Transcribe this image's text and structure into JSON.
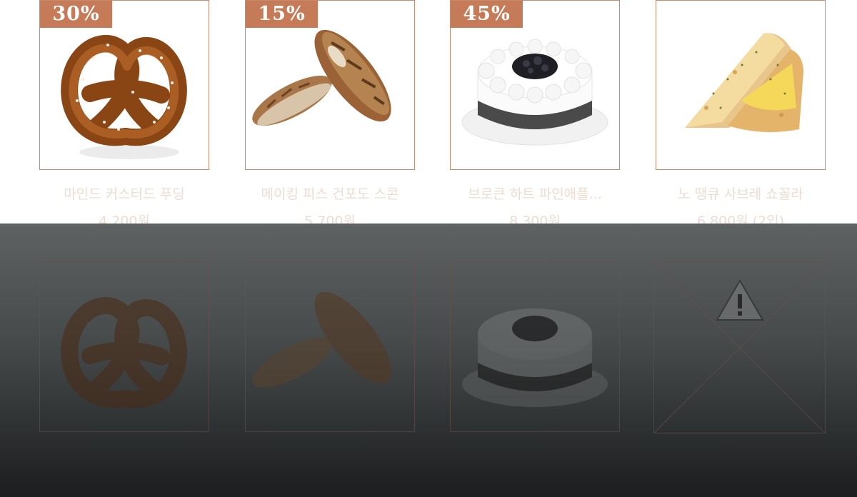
{
  "products": [
    {
      "discount": "30%",
      "name": "마인드 커스터드 푸딩",
      "price": "4,200원",
      "image_icon": "pretzel-image"
    },
    {
      "discount": "15%",
      "name": "메이킹 피스 건포도 스콘",
      "price": "5,700원",
      "image_icon": "baguette-image"
    },
    {
      "discount": "45%",
      "name": "브로큰 하트 파인애플...",
      "price": "8,300원",
      "image_icon": "cake-image"
    },
    {
      "discount": "",
      "name": "노 땡큐 사브레 쇼꼴라",
      "price": "6,800원 (2입)",
      "image_icon": "toast-sandwich-image"
    }
  ],
  "colors": {
    "accent": "#c57b58",
    "border": "#c88a6c",
    "muted_text": "#ecdcd2"
  }
}
